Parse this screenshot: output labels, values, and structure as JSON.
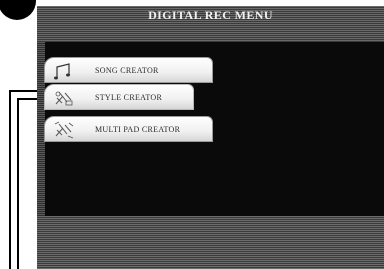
{
  "screen": {
    "title": "DIGITAL REC MENU"
  },
  "menu": {
    "items": [
      {
        "label": "SONG CREATOR",
        "icon": "music-note-icon"
      },
      {
        "label": "STYLE CREATOR",
        "icon": "style-icon"
      },
      {
        "label": "MULTI PAD CREATOR",
        "icon": "multi-pad-icon"
      }
    ],
    "selected_index": 1
  },
  "colors": {
    "screen_bg": "#0b0b0b",
    "tab_bg": "#f0f0f0",
    "title_text": "#f2f2f2"
  }
}
